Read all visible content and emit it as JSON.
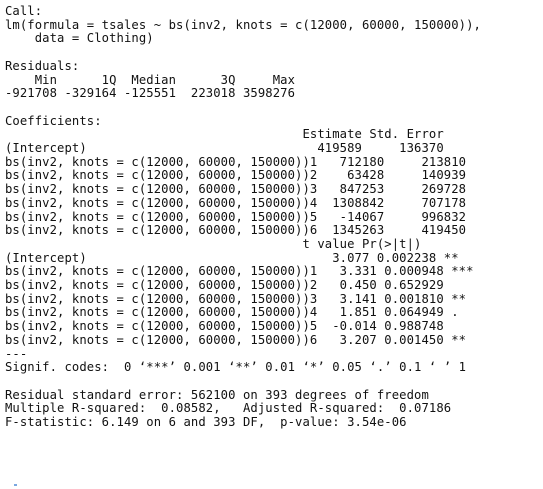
{
  "call": {
    "heading": "Call:",
    "line1": "lm(formula = tsales ~ bs(inv2, knots = c(12000, 60000, 150000)),",
    "line2": "    data = Clothing)"
  },
  "residuals": {
    "heading": "Residuals:",
    "header": "    Min      1Q  Median      3Q     Max ",
    "values": "-921708 -329164 -125551  223018 3598276 "
  },
  "coefficients": {
    "heading": "Coefficients:",
    "estimates_header": "                                        Estimate Std. Error",
    "estimates_rows": [
      "(Intercept)                               419589     136370",
      "bs(inv2, knots = c(12000, 60000, 150000))1   712180     213810",
      "bs(inv2, knots = c(12000, 60000, 150000))2    63428     140939",
      "bs(inv2, knots = c(12000, 60000, 150000))3   847253     269728",
      "bs(inv2, knots = c(12000, 60000, 150000))4  1308842     707178",
      "bs(inv2, knots = c(12000, 60000, 150000))5   -14067     996832",
      "bs(inv2, knots = c(12000, 60000, 150000))6  1345263     419450"
    ],
    "tvalues_header": "                                        t value Pr(>|t|)    ",
    "tvalues_rows": [
      "(Intercept)                                 3.077 0.002238 ** ",
      "bs(inv2, knots = c(12000, 60000, 150000))1   3.331 0.000948 ***",
      "bs(inv2, knots = c(12000, 60000, 150000))2   0.450 0.652929    ",
      "bs(inv2, knots = c(12000, 60000, 150000))3   3.141 0.001810 ** ",
      "bs(inv2, knots = c(12000, 60000, 150000))4   1.851 0.064949 .  ",
      "bs(inv2, knots = c(12000, 60000, 150000))5  -0.014 0.988748    ",
      "bs(inv2, knots = c(12000, 60000, 150000))6   3.207 0.001450 ** "
    ],
    "separator": "---",
    "signif_codes": "Signif. codes:  0 ‘***’ 0.001 ‘**’ 0.01 ‘*’ 0.05 ‘.’ 0.1 ‘ ’ 1"
  },
  "summary": {
    "residual_se": "Residual standard error: 562100 on 393 degrees of freedom",
    "r_squared": "Multiple R-squared:  0.08582,\tAdjusted R-squared:  0.07186 ",
    "f_statistic": "F-statistic: 6.149 on 6 and 393 DF,  p-value: 3.54e-06"
  }
}
